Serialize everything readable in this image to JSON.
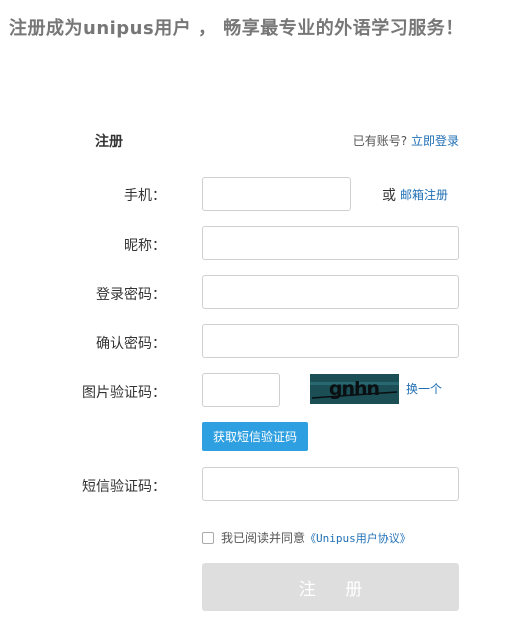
{
  "banner": {
    "text": "注册成为unipus用户 ， 畅享最专业的外语学习服务！"
  },
  "form": {
    "title": "注册",
    "login_prompt": "已有账号?",
    "login_link": "立即登录",
    "phone_label": "手机：",
    "or_text": "或",
    "email_register_link": "邮箱注册",
    "nickname_label": "昵称：",
    "password_label": "登录密码：",
    "confirm_password_label": "确认密码：",
    "captcha_label": "图片验证码：",
    "captcha_text": "gnhn",
    "refresh_captcha_link": "换一个",
    "sms_button": "获取短信验证码",
    "sms_code_label": "短信验证码：",
    "agree_text": "我已阅读并同意",
    "agreement_link": "《Unipus用户协议》",
    "submit_button": "注 册",
    "agree_checked": false
  },
  "colors": {
    "link": "#1f6fb5",
    "sms_button_bg": "#2e9fe0",
    "submit_disabled_bg": "#dedede",
    "banner_text": "#777777",
    "captcha_bg": "#1c4e55",
    "captcha_text": "#0a0f12"
  }
}
